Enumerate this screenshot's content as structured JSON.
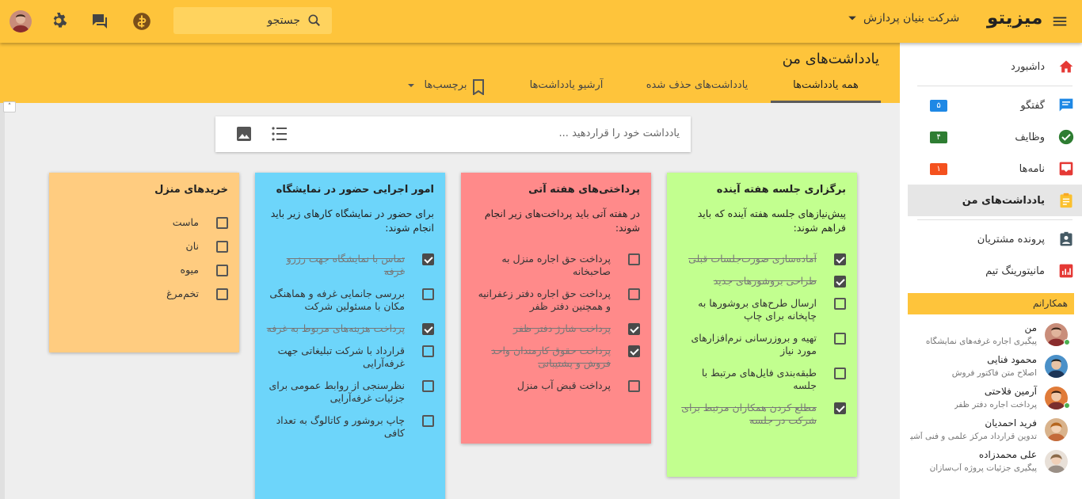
{
  "topbar": {
    "logo": "میزیتو",
    "company": "شرکت بنیان پردازش",
    "search_placeholder": "جستجو",
    "accent": "#FEC43B"
  },
  "page": {
    "title": "یادداشت‌های من",
    "tabs": [
      {
        "label": "همه یادداشت‌ها",
        "active": true
      },
      {
        "label": "یادداشت‌های حذف شده",
        "active": false
      },
      {
        "label": "آرشیو یادداشت‌ها",
        "active": false
      },
      {
        "label": "برچسب‌ها",
        "active": false
      }
    ],
    "note_input_placeholder": "یادداشت خود را قراردهید ..."
  },
  "notes": [
    {
      "title": "برگزاری جلسه هفته آینده",
      "color": "#C2FF8F",
      "body": "پیش‌نیازهای جلسه هفته آینده که باید فراهم شوند:",
      "items": [
        {
          "text": "آماده‌سازی صورت‌جلسات قبلی",
          "done": true
        },
        {
          "text": "طراحی بروشورهای جدید",
          "done": true
        },
        {
          "text": "ارسال طرح‌های بروشورها به چاپخانه برای چاپ",
          "done": false
        },
        {
          "text": "تهیه و بروزرسانی نرم‌افزارهای مورد نیاز",
          "done": false
        },
        {
          "text": "طبقه‌بندی فایل‌های مرتبط با جلسه",
          "done": false
        },
        {
          "text": "مطلع کردن همکاران مرتبط برای شرکت در جلسه",
          "done": true
        }
      ]
    },
    {
      "title": "پرداختی‌های هفته آتی",
      "color": "#FF8A8A",
      "body": "در هفته آتی باید پرداخت‌های زیر انجام شوند:",
      "items": [
        {
          "text": "پرداخت حق اجاره منزل به صاحبخانه",
          "done": false
        },
        {
          "text": "پرداخت حق اجاره دفتر زعفرانیه و همچنین دفتر ظفر",
          "done": false
        },
        {
          "text": "پرداخت شارژ دفتر ظفر",
          "done": true
        },
        {
          "text": "پرداخت حقوق کارمندان واحد فروش و پشتیبانی",
          "done": true
        },
        {
          "text": "پرداخت قبض آب منزل",
          "done": false
        }
      ]
    },
    {
      "title": "امور اجرایی حضور در نمایشگاه",
      "color": "#6DD5FA",
      "body": "برای حضور در نمایشگاه کارهای زیر باید انجام شوند:",
      "items": [
        {
          "text": "تماس با نمایشگاه جهت رزرو غرفه",
          "done": true
        },
        {
          "text": "بررسی جانمایی غرفه و هماهنگی مکان با مسئولین شرکت",
          "done": false
        },
        {
          "text": "پرداخت هزینه‌های مربوط به غرفه",
          "done": true
        },
        {
          "text": "قرارداد با شرکت تبلیغاتی جهت غرفه‌آرایی",
          "done": false
        },
        {
          "text": "نظرسنجی از روابط عمومی برای جزئیات غرفه‌آرایی",
          "done": false
        },
        {
          "text": "چاپ بروشور و کاتالوگ به تعداد کافی",
          "done": false
        }
      ]
    },
    {
      "title": "خریدهای منزل",
      "color": "#FFCC80",
      "body": "",
      "items": [
        {
          "text": "ماست",
          "done": false
        },
        {
          "text": "نان",
          "done": false
        },
        {
          "text": "میوه",
          "done": false
        },
        {
          "text": "تخم‌مرغ",
          "done": false
        }
      ]
    }
  ],
  "sidebar": {
    "items": [
      {
        "label": "داشبورد",
        "icon": "home-icon",
        "color": "#E53935"
      },
      {
        "label": "گفتگو",
        "icon": "chat-icon",
        "color": "#1E88E5",
        "badge": "۵",
        "badge_color": "#1E88E5"
      },
      {
        "label": "وظایف",
        "icon": "check-circle-icon",
        "color": "#2E7D32",
        "badge": "۴",
        "badge_color": "#2E7D32"
      },
      {
        "label": "نامه‌ها",
        "icon": "inbox-icon",
        "color": "#E53935",
        "badge": "۱",
        "badge_color": "#F4511E"
      },
      {
        "label": "یادداشت‌های من",
        "icon": "note-icon",
        "color": "#FBC02D",
        "active": true
      },
      {
        "label": "پرونده مشتریان",
        "icon": "contact-card-icon",
        "color": "#455A64"
      },
      {
        "label": "مانیتورینگ تیم",
        "icon": "bar-chart-icon",
        "color": "#E53935"
      }
    ],
    "colleagues_header": "همکارانم",
    "colleagues": [
      {
        "name": "من",
        "status": "پیگیری اجاره غرفه‌های نمایشگاه",
        "online": true
      },
      {
        "name": "محمود فنایی",
        "status": "اصلاح متن فاکتور فروش",
        "online": false
      },
      {
        "name": "آرمین فلاحتی",
        "status": "پرداخت اجاره دفتر ظفر",
        "online": true
      },
      {
        "name": "فرید احمدیان",
        "status": "تدوین قرارداد مرکز علمی و فنی آشیا...",
        "online": false
      },
      {
        "name": "علی محمدزاده",
        "status": "پیگیری جزئیات پروژه آب‌سازان",
        "online": false
      }
    ]
  }
}
